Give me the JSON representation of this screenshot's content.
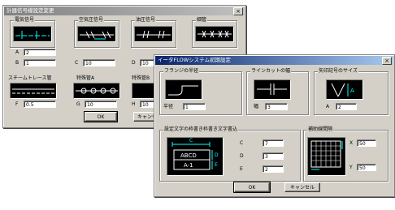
{
  "win1": {
    "title": "計器信号線設定変更",
    "close": "×",
    "groups": {
      "elec": {
        "title": "電気信号"
      },
      "pneu": {
        "title": "空気圧信号"
      },
      "hyd": {
        "title": "油圧信号"
      },
      "cap": {
        "title": "細管"
      }
    },
    "fields": {
      "A": {
        "label": "A",
        "value": "2"
      },
      "B": {
        "label": "B",
        "value": "1"
      },
      "C": {
        "label": "C",
        "value": "10"
      },
      "D": {
        "label": "D",
        "value": "10"
      },
      "F": {
        "label": "F",
        "value": "0.5"
      },
      "G": {
        "label": "G",
        "value": "10"
      },
      "H": {
        "label": "H",
        "value": "10"
      }
    },
    "steam_label": "スチームトレース管",
    "specialA_label": "特殊管A",
    "specialB_label": "特殊管B",
    "ok": "OK",
    "cancel": "キャンセル"
  },
  "win2": {
    "title": "イータFLOWシステム初期設定",
    "close": "×",
    "groups": {
      "flange": {
        "title": "フランジの半径",
        "field_label": "半径",
        "value": "1"
      },
      "line": {
        "title": "ラインカットの幅",
        "field_label": "幅",
        "value": "3"
      },
      "arrow": {
        "title": "矢印記号のサイズ",
        "field_label": "A",
        "value": "2"
      },
      "text": {
        "title": "設定文字の枠書き枠書き文字書込",
        "preview_c": "C",
        "preview_abcd": "ABCD",
        "preview_a1": "A-1",
        "preview_d": "D",
        "preview_e": "E",
        "fields": [
          {
            "label": "C",
            "value": "7"
          },
          {
            "label": "D",
            "value": "3"
          },
          {
            "label": "E",
            "value": "2"
          }
        ]
      },
      "hatch": {
        "title": "補助線間隔",
        "x_label": "X",
        "x_value": "50",
        "y_label": "Y",
        "y_value": "50"
      }
    },
    "ok": "OK",
    "cancel": "キャンセル"
  },
  "colors": {
    "face": "#d4d0c8",
    "preview_bg": "#000000",
    "preview_line": "#00ffff",
    "title_active": "#0a246a"
  }
}
